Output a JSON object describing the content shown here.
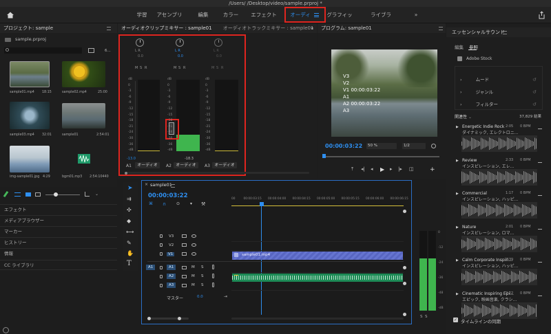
{
  "app": {
    "title": "/Users/          /Desktop/video/sample.prproj *"
  },
  "workspaces": {
    "items": [
      "学習",
      "アセンブリ",
      "編集",
      "カラー",
      "エフェクト",
      "オーディオ",
      "グラフィック",
      "ライブラリ"
    ],
    "active": "オーディオ",
    "more": "»"
  },
  "project": {
    "title": "プロジェクト: sample",
    "file": "sample.prproj",
    "count": "6...",
    "items": [
      {
        "name": "sample01.mp4",
        "dur": "18:15"
      },
      {
        "name": "sample02.mp4",
        "dur": "25:00"
      },
      {
        "name": "sample03.mp4",
        "dur": "32:01"
      },
      {
        "name": "sample01",
        "dur": "2:54:01"
      },
      {
        "name": "img-sample01.jpg",
        "dur": "4:29"
      },
      {
        "name": "bgm01.mp3",
        "dur": "2:54:10440"
      }
    ]
  },
  "left_menu": [
    "エフェクト",
    "メディアブラウザー",
    "マーカー",
    "ヒストリー",
    "情報",
    "CC ライブラリ"
  ],
  "mixer": {
    "tab_active": "オーディオクリップミキサー : sample01",
    "tab_other": "オーディオトラックミキサー : sample01",
    "more": "»",
    "channels": [
      {
        "lr": "L     R",
        "val": "0.0",
        "db": "-13.0",
        "track": "A1",
        "name": "オーディオ"
      },
      {
        "lr": "L     R",
        "val": "0.0",
        "db": "-18.3",
        "track": "A2",
        "name": "オーディオ"
      },
      {
        "lr": "L     R",
        "val": "0.0",
        "db": "",
        "track": "A3",
        "name": "オーディオ"
      }
    ],
    "scale": [
      "dB",
      "0",
      "-3",
      "-6",
      "-9",
      "-12",
      "-15",
      "-18",
      "-21",
      "-24",
      "-30",
      "-36",
      "-dB"
    ],
    "msr": [
      "M",
      "S",
      "R"
    ]
  },
  "program": {
    "title": "プログラム: sample01",
    "overlay": [
      "V3",
      "V2",
      "V1 00:00:03:22",
      "A1",
      "A2 00:00:03:22",
      "A3"
    ],
    "timecode": "00:00:03:22",
    "zoom": "50 %",
    "quality": "1/2"
  },
  "timeline": {
    "tab": "sample01",
    "timecode": "00:00:03:22",
    "ruler": [
      "00",
      "00:00:03:15",
      "00:00:04:00",
      "00:00:04:15",
      "00:00:05:00",
      "00:00:05:15",
      "00:00:06:00",
      "00:00:06:15"
    ],
    "video_tracks": [
      "V3",
      "V2",
      "V1"
    ],
    "audio_tracks": [
      "A1",
      "A2",
      "A3"
    ],
    "source_patch": "A1",
    "master_label": "マスター",
    "master_value": "0.0",
    "clip_label": "sample01.mp4",
    "btn_m": "M",
    "btn_s": "S",
    "meter_scale": [
      "0",
      "-12",
      "-24",
      "-36",
      "-48",
      "-dB"
    ],
    "meter_ss": "S  S"
  },
  "essential": {
    "title": "エッセンシャルサウンド",
    "tabs": [
      "編集",
      "参照"
    ],
    "adobe_stock": "Adobe Stock",
    "filters": [
      "ムード",
      "ジャンル",
      "フィルター"
    ],
    "sort": "関連性",
    "results": "37,829 結果",
    "tracks": [
      {
        "title": "Energetic Indie Rock",
        "time": "2:05",
        "bpm": "0 BPM",
        "sub": "ダイナミック, エレクトロニ..."
      },
      {
        "title": "Review",
        "time": "2:33",
        "bpm": "0 BPM",
        "sub": "インスピレーション, エレ..."
      },
      {
        "title": "Commercial",
        "time": "1:17",
        "bpm": "0 BPM",
        "sub": "インスピレーション, ハッピ..."
      },
      {
        "title": "Nature",
        "time": "2:01",
        "bpm": "0 BPM",
        "sub": "インスピレーション, ロマ..."
      },
      {
        "title": "Calm Corporate Inspiri...",
        "time": "2:39",
        "bpm": "0 BPM",
        "sub": "インスピレーション, ハッピ..."
      },
      {
        "title": "Cinematic Inspiring Epi...",
        "time": "2:22",
        "bpm": "0 BPM",
        "sub": "エピック, 映画音楽, クラシ..."
      }
    ],
    "sync_label": "タイムラインの同期"
  },
  "colors": {
    "accent": "#2e8ff0",
    "highlight": "#e0251f",
    "meter_green": "#39b54a",
    "clip_video": "#5b6cc4",
    "clip_audio": "#1e9a5c"
  }
}
